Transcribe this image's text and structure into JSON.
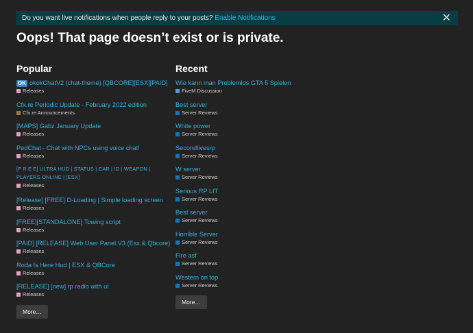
{
  "notification": {
    "text": "Do you want live notifications when people reply to your posts?",
    "link": "Enable Notifications",
    "close": "✕"
  },
  "page_title": "Oops! That page doesn’t exist or is private.",
  "popular": {
    "heading": "Popular",
    "items": [
      {
        "badge": "OK",
        "title": "okokChatV2 (chat-theme) [QBCORE][ESX][PAID]",
        "category": "Releases",
        "color": "#e4a1c3"
      },
      {
        "title": "Cfx.re Periodic Update - February 2022 edition",
        "category": "Cfx.re Announcements",
        "color": "#a6743f"
      },
      {
        "title": "[MAPS] Gabz January Update",
        "category": "Releases",
        "color": "#e4a1c3"
      },
      {
        "title": "PedChat - Chat with NPCs using voice chat!",
        "category": "Releases",
        "color": "#e4a1c3"
      },
      {
        "title": "[F R E E] ULTRA HUD | STATUS | CAR | ID | WEAPON | PLAYERS ONLINE | [ESX]",
        "category": "Releases",
        "color": "#e4a1c3"
      },
      {
        "title": "[Release] [FREE] D-Loading | Simple loading screen",
        "category": "Releases",
        "color": "#e4a1c3"
      },
      {
        "title": "[FREE][STANDALONE] Towing script",
        "category": "Releases",
        "color": "#e4a1c3"
      },
      {
        "title": "[PAID] [RELEASE] Web User Panel V3 (Esx & Qbcore)",
        "category": "Releases",
        "color": "#e4a1c3"
      },
      {
        "title": "Roda Is Here Hud | ESX & QBCore",
        "category": "Releases",
        "color": "#e4a1c3"
      },
      {
        "title": "[RELEASE] [new] rp radio with ui",
        "category": "Releases",
        "color": "#e4a1c3"
      }
    ],
    "more": "More…"
  },
  "recent": {
    "heading": "Recent",
    "items": [
      {
        "title": "Wie kann man Problemlos GTA 5 Spielen",
        "category": "FiveM Discussion",
        "color": "#4f9fd4"
      },
      {
        "title": "Best server",
        "category": "Server Reviews",
        "color": "#0e76bd"
      },
      {
        "title": "White power",
        "category": "Server Reviews",
        "color": "#0e76bd"
      },
      {
        "title": "Secondlivesrp",
        "category": "Server Reviews",
        "color": "#0e76bd"
      },
      {
        "title": "W server",
        "category": "Server Reviews",
        "color": "#0e76bd"
      },
      {
        "title": "Serious RP LIT",
        "category": "Server Reviews",
        "color": "#0e76bd"
      },
      {
        "title": "Best server",
        "category": "Server Reviews",
        "color": "#0e76bd"
      },
      {
        "title": "Horrible Server",
        "category": "Server Reviews",
        "color": "#0e76bd"
      },
      {
        "title": "Fire asf",
        "category": "Server Reviews",
        "color": "#0e76bd"
      },
      {
        "title": "Western on top",
        "category": "Server Reviews",
        "color": "#0e76bd"
      }
    ],
    "more": "More…"
  }
}
